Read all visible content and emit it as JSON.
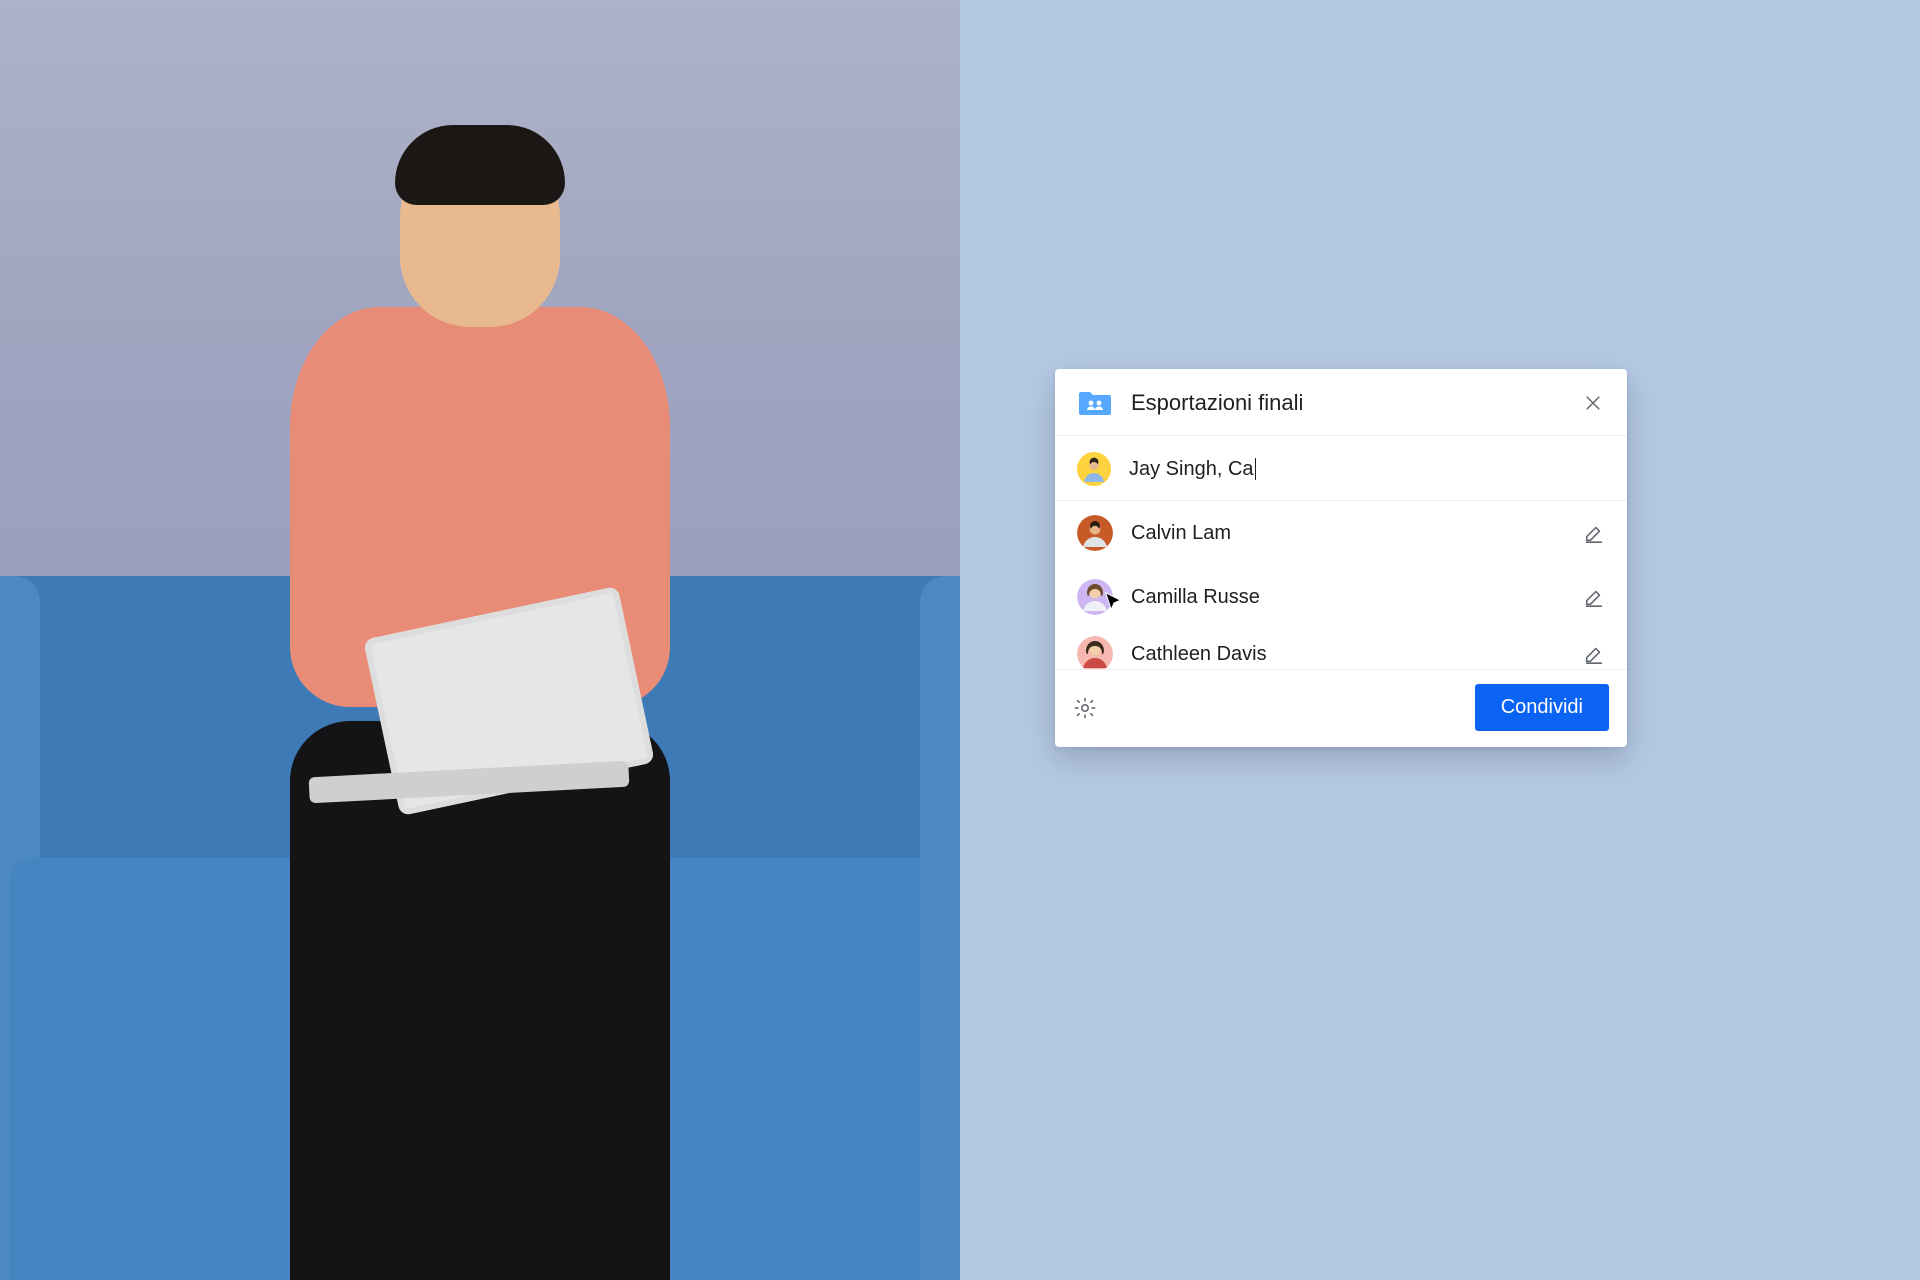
{
  "dialog": {
    "folder_name": "Esportazioni finali",
    "input_value": "Jay Singh, Ca",
    "input_avatar_color": "#ffd23f",
    "share_button": "Condividi",
    "suggestions": [
      {
        "name": "Calvin Lam",
        "avatar_color": "#c85a27"
      },
      {
        "name": "Camilla Russe",
        "avatar_color": "#c9b3ef"
      },
      {
        "name": "Cathleen Davis",
        "avatar_color": "#f4a3a3"
      }
    ]
  },
  "colors": {
    "right_bg": "#b4c8e4",
    "accent": "#0b63f3",
    "folder": "#56a8ff"
  }
}
